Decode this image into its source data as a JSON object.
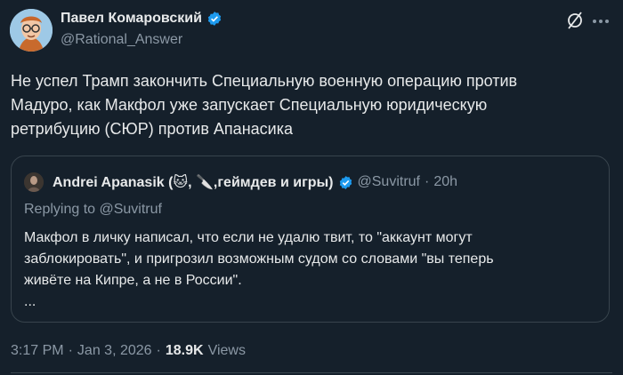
{
  "author": {
    "display_name": "Павел Комаровский",
    "handle": "@Rational_Answer",
    "verified": true
  },
  "tweet": {
    "text": "Не успел Трамп закончить Специальную военную операцию против\nМадуро, как Макфол уже запускает Специальную юридическую\nретрибуцию (СЮР) против Апанасика"
  },
  "quote": {
    "display_name": "Andrei Apanasik (🐱, 🔪,геймдев и игры)",
    "handle": "@Suvitruf",
    "separator": "·",
    "time": "20h",
    "replying_to": "Replying to @Suvitruf",
    "text": "Макфол в личку написал, что если не удалю твит, то \"аккаунт могут\nзаблокировать\", и пригрозил возможным судом со словами \"вы теперь\nживёте на Кипре, а не в России\".\n..."
  },
  "meta": {
    "time": "3:17 PM",
    "separator1": "·",
    "date": "Jan 3, 2026",
    "separator2": "·",
    "views_count": "18.9K",
    "views_label": "Views"
  },
  "colors": {
    "background": "#15202b",
    "text": "#e7e9ea",
    "secondary": "#8b98a5",
    "verified_blue": "#1d9bf0",
    "border": "#38444d"
  },
  "icons": [
    "grok-icon",
    "more-icon",
    "verified-badge-icon"
  ]
}
